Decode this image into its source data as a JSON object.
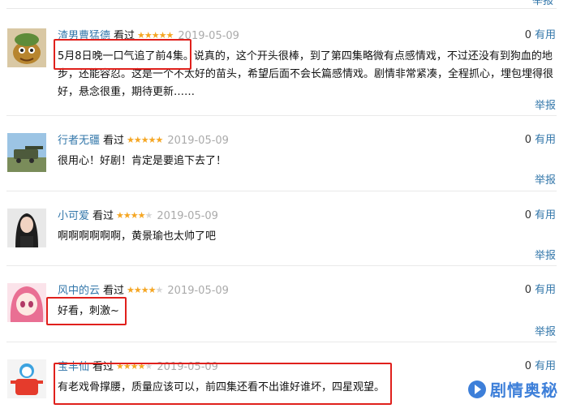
{
  "top": {
    "report_label": "举报"
  },
  "comments": [
    {
      "author": "渣男曹猛德",
      "watched": "看过",
      "rating": 5,
      "date": "2019-05-09",
      "useful_count": "0",
      "useful_label": "有用",
      "text": "5月8日晚一口气追了前4集。说真的，这个开头很棒，到了第四集略微有点感情戏，不过还没有到狗血的地步，还能容忍。这是一个不太好的苗头，希望后面不会长篇感情戏。剧情非常紧凑，全程抓心，埋包埋得很好，悬念很重，期待更新……",
      "report_label": "举报"
    },
    {
      "author": "行者无疆",
      "watched": "看过",
      "rating": 5,
      "date": "2019-05-09",
      "useful_count": "0",
      "useful_label": "有用",
      "text": "很用心！好剧！肯定是要追下去了！",
      "report_label": "举报"
    },
    {
      "author": "小可爱",
      "watched": "看过",
      "rating": 4,
      "date": "2019-05-09",
      "useful_count": "0",
      "useful_label": "有用",
      "text": "啊啊啊啊啊啊，黄景瑜也太帅了吧",
      "report_label": "举报"
    },
    {
      "author": "风中的云",
      "watched": "看过",
      "rating": 4,
      "date": "2019-05-09",
      "useful_count": "0",
      "useful_label": "有用",
      "text": "好看，刺激~",
      "report_label": "举报"
    },
    {
      "author": "宝丰仙",
      "watched": "看过",
      "rating": 4,
      "date": "2019-05-09",
      "useful_count": "0",
      "useful_label": "有用",
      "text": "有老戏骨撑腰，质量应该可以，前四集还看不出谁好谁坏，四星观望。",
      "report_label": ""
    }
  ],
  "watermark": {
    "text": "剧情奥秘"
  },
  "colors": {
    "link": "#3377aa",
    "star": "#f5a623",
    "highlight": "#e0201c",
    "watermark": "#3d7fd9"
  }
}
